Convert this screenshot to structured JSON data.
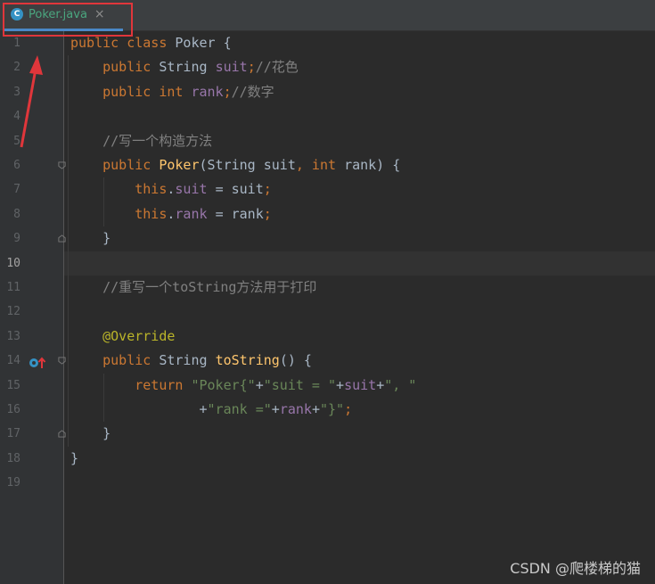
{
  "tab": {
    "icon_letter": "C",
    "label": "Poker.java",
    "close_glyph": "×"
  },
  "editor": {
    "current_line": 10,
    "line_numbers": [
      "1",
      "2",
      "3",
      "4",
      "5",
      "6",
      "7",
      "8",
      "9",
      "10",
      "11",
      "12",
      "13",
      "14",
      "15",
      "16",
      "17",
      "18",
      "19"
    ],
    "lines": [
      [
        {
          "t": "kw",
          "s": "public class "
        },
        {
          "t": "plain",
          "s": "Poker {"
        }
      ],
      [
        {
          "t": "kw",
          "s": "    public "
        },
        {
          "t": "plain",
          "s": "String "
        },
        {
          "t": "field",
          "s": "suit"
        },
        {
          "t": "kw",
          "s": ";"
        },
        {
          "t": "comment",
          "s": "//花色"
        }
      ],
      [
        {
          "t": "kw",
          "s": "    public int "
        },
        {
          "t": "field",
          "s": "rank"
        },
        {
          "t": "kw",
          "s": ";"
        },
        {
          "t": "comment",
          "s": "//数字"
        }
      ],
      [],
      [
        {
          "t": "comment",
          "s": "    //写一个构造方法"
        }
      ],
      [
        {
          "t": "kw",
          "s": "    public "
        },
        {
          "t": "method",
          "s": "Poker"
        },
        {
          "t": "plain",
          "s": "(String suit"
        },
        {
          "t": "kw",
          "s": ", int "
        },
        {
          "t": "plain",
          "s": "rank) {"
        }
      ],
      [
        {
          "t": "kw",
          "s": "        this"
        },
        {
          "t": "plain",
          "s": "."
        },
        {
          "t": "field",
          "s": "suit "
        },
        {
          "t": "plain",
          "s": "= suit"
        },
        {
          "t": "kw",
          "s": ";"
        }
      ],
      [
        {
          "t": "kw",
          "s": "        this"
        },
        {
          "t": "plain",
          "s": "."
        },
        {
          "t": "field",
          "s": "rank "
        },
        {
          "t": "plain",
          "s": "= rank"
        },
        {
          "t": "kw",
          "s": ";"
        }
      ],
      [
        {
          "t": "plain",
          "s": "    }"
        }
      ],
      [],
      [
        {
          "t": "comment",
          "s": "    //重写一个toString方法用于打印"
        }
      ],
      [],
      [
        {
          "t": "ann",
          "s": "    @Override"
        }
      ],
      [
        {
          "t": "kw",
          "s": "    public "
        },
        {
          "t": "plain",
          "s": "String "
        },
        {
          "t": "method",
          "s": "toString"
        },
        {
          "t": "plain",
          "s": "() {"
        }
      ],
      [
        {
          "t": "kw",
          "s": "        return "
        },
        {
          "t": "str",
          "s": "\"Poker{\""
        },
        {
          "t": "plain",
          "s": "+"
        },
        {
          "t": "str",
          "s": "\"suit = \""
        },
        {
          "t": "plain",
          "s": "+"
        },
        {
          "t": "field",
          "s": "suit"
        },
        {
          "t": "plain",
          "s": "+"
        },
        {
          "t": "str",
          "s": "\", \""
        }
      ],
      [
        {
          "t": "plain",
          "s": "                +"
        },
        {
          "t": "str",
          "s": "\"rank =\""
        },
        {
          "t": "plain",
          "s": "+"
        },
        {
          "t": "field",
          "s": "rank"
        },
        {
          "t": "plain",
          "s": "+"
        },
        {
          "t": "str",
          "s": "\"}\""
        },
        {
          "t": "kw",
          "s": ";"
        }
      ],
      [
        {
          "t": "plain",
          "s": "    }"
        }
      ],
      [
        {
          "t": "plain",
          "s": "}"
        }
      ],
      []
    ]
  },
  "gutter_icons": {
    "override": "override-method-icon"
  },
  "colors": {
    "background": "#2b2b2b",
    "keyword": "#cc7832",
    "field": "#9876aa",
    "string": "#6a8759",
    "comment": "#808080",
    "annotation": "#bbb529",
    "method": "#ffc66d",
    "annotation_red": "#e0363b"
  },
  "watermark": "CSDN @爬楼梯的猫"
}
